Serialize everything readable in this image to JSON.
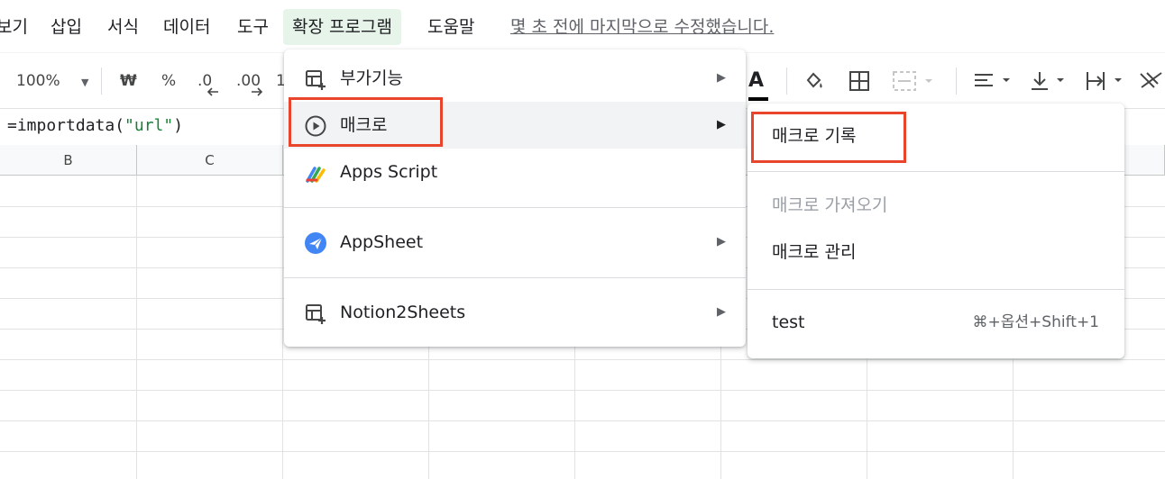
{
  "menubar": {
    "items": [
      "보기",
      "삽입",
      "서식",
      "데이터",
      "도구",
      "확장 프로그램",
      "도움말"
    ],
    "last_edit": "몇 초 전에 마지막으로 수정했습니다."
  },
  "toolbar": {
    "zoom": "100%",
    "currency": "₩",
    "percent": "%",
    "decrease_decimal": ".0",
    "increase_decimal": ".00",
    "more_formats": "1",
    "text_color_letter": "A"
  },
  "formula_bar": {
    "prefix": "=importdata(",
    "string": "\"url\"",
    "suffix": ")"
  },
  "grid": {
    "columns": [
      "B",
      "C"
    ]
  },
  "extensions_menu": {
    "items": [
      {
        "label": "부가기능",
        "icon": "addons-icon",
        "has_submenu": true
      },
      {
        "label": "매크로",
        "icon": "play-circle-icon",
        "has_submenu": true,
        "highlighted": true
      },
      {
        "label": "Apps Script",
        "icon": "apps-script-icon",
        "has_submenu": false
      },
      {
        "label": "AppSheet",
        "icon": "appsheet-icon",
        "has_submenu": true
      },
      {
        "label": "Notion2Sheets",
        "icon": "addons-icon",
        "has_submenu": true
      }
    ],
    "arrow": "▶"
  },
  "macro_submenu": {
    "record": "매크로 기록",
    "import": "매크로 가져오기",
    "manage": "매크로 관리",
    "test_macro": "test",
    "test_shortcut": "⌘+옵션+Shift+1"
  },
  "colors": {
    "highlight_box": "#e8452c",
    "active_menu_bg": "#e6f4ea",
    "formula_string": "#188038"
  }
}
